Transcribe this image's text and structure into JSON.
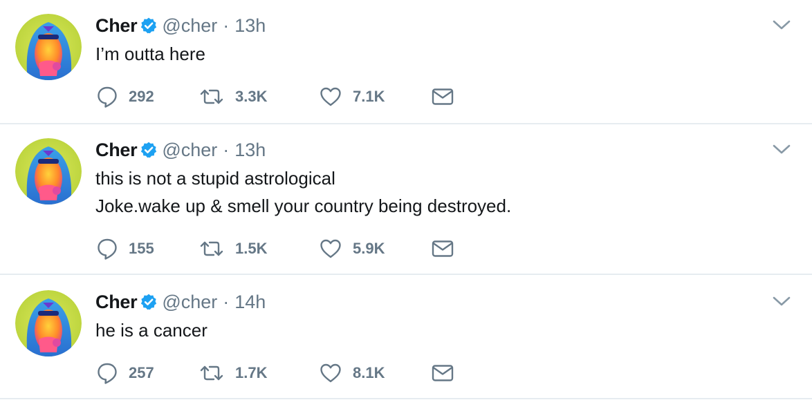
{
  "colors": {
    "text_primary": "#14171a",
    "text_secondary": "#657786",
    "verified_blue": "#1da1f2",
    "divider": "#e6ecf0"
  },
  "icons": {
    "verified": "verified-badge-icon",
    "caret": "chevron-down-icon",
    "reply": "reply-bubble-icon",
    "retweet": "retweet-arrows-icon",
    "like": "heart-icon",
    "dm": "envelope-icon"
  },
  "tweets": [
    {
      "name": "Cher",
      "handle": "@cher",
      "separator": "·",
      "time": "13h",
      "lines": [
        "I’m outta here"
      ],
      "replies": "292",
      "retweets": "3.3K",
      "likes": "7.1K"
    },
    {
      "name": "Cher",
      "handle": "@cher",
      "separator": "·",
      "time": "13h",
      "lines": [
        "this is not a stupid astrological",
        "Joke.wake up & smell your country being destroyed."
      ],
      "replies": "155",
      "retweets": "1.5K",
      "likes": "5.9K"
    },
    {
      "name": "Cher",
      "handle": "@cher",
      "separator": "·",
      "time": "14h",
      "lines": [
        "he is a cancer"
      ],
      "replies": "257",
      "retweets": "1.7K",
      "likes": "8.1K"
    }
  ]
}
